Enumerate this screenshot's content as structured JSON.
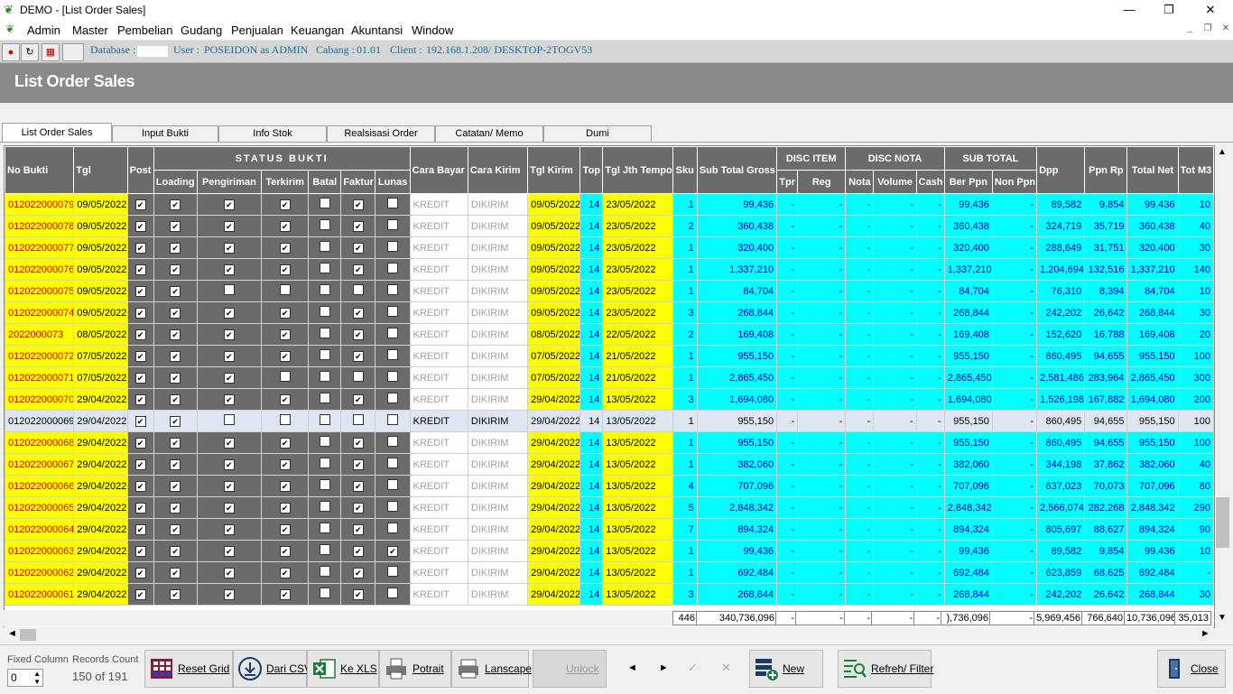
{
  "window": {
    "title": "DEMO - [List Order Sales]",
    "minimize": "—",
    "restore": "❐",
    "close": "✕"
  },
  "menu": [
    "Admin",
    "Master",
    "Pembelian",
    "Gudang",
    "Penjualan",
    "Keuangan",
    "Akuntansi",
    "Window"
  ],
  "infobar": {
    "database_label": "Database :",
    "user_label": "User :",
    "user_value": "POSEIDON as ADMIN",
    "cabang_label": "Cabang :",
    "cabang_value": "01.01",
    "client_label": "Client :",
    "client_value": "192.168.1.208/ DESKTOP-2TOGV53"
  },
  "page_title": "List Order Sales",
  "tabs": [
    "List Order Sales",
    "Input Bukti",
    "Info Stok",
    "Realsisasi Order",
    "Catatan/ Memo",
    "Dumi"
  ],
  "headers": {
    "no_bukti": "No Bukti",
    "tgl": "Tgl",
    "post": "Post",
    "status_bukti": "STATUS BUKTI",
    "loading": "Loading",
    "pengiriman": "Pengiriman",
    "terkirim": "Terkirim",
    "batal": "Batal",
    "faktur": "Faktur",
    "lunas": "Lunas",
    "cara_bayar": "Cara Bayar",
    "cara_kirim": "Cara Kirim",
    "tgl_kirim": "Tgl Kirim",
    "top": "Top",
    "tgl_jth_tempo": "Tgl Jth Tempo",
    "sku": "Sku",
    "sub_total_gross": "Sub Total Gross",
    "disc_item": "DISC ITEM",
    "tpr": "Tpr",
    "reg": "Reg",
    "disc_nota": "DISC NOTA",
    "nota": "Nota",
    "volume": "Volume",
    "cash": "Cash",
    "sub_total": "SUB TOTAL",
    "ber_ppn": "Ber Ppn",
    "non_ppn": "Non Ppn",
    "dpp": "Dpp",
    "ppn_rp": "Ppn Rp",
    "total_net": "Total Net",
    "tot_m3": "Tot M3"
  },
  "rows": [
    {
      "no": "012022000079",
      "tgl": "09/05/2022",
      "ck": [
        1,
        1,
        1,
        1,
        0,
        1,
        0
      ],
      "bayar": "KREDIT",
      "kirim": "DIKIRIM",
      "tglkirim": "09/05/2022",
      "top": "14",
      "jth": "23/05/2022",
      "sku": "1",
      "gross": "99,436",
      "tpr": "-",
      "reg": "-",
      "nota": "-",
      "vol": "-",
      "cash": "-",
      "ber": "99,436",
      "non": "-",
      "dpp": "89,582",
      "ppn": "9,854",
      "net": "99,436",
      "m3": "10"
    },
    {
      "no": "012022000078",
      "tgl": "09/05/2022",
      "ck": [
        1,
        1,
        1,
        1,
        0,
        1,
        0
      ],
      "bayar": "KREDIT",
      "kirim": "DIKIRIM",
      "tglkirim": "09/05/2022",
      "top": "14",
      "jth": "23/05/2022",
      "sku": "2",
      "gross": "360,438",
      "tpr": "-",
      "reg": "-",
      "nota": "-",
      "vol": "-",
      "cash": "-",
      "ber": "360,438",
      "non": "-",
      "dpp": "324,719",
      "ppn": "35,719",
      "net": "360,438",
      "m3": "40"
    },
    {
      "no": "012022000077",
      "tgl": "09/05/2022",
      "ck": [
        1,
        1,
        1,
        1,
        0,
        1,
        0
      ],
      "bayar": "KREDIT",
      "kirim": "DIKIRIM",
      "tglkirim": "09/05/2022",
      "top": "14",
      "jth": "23/05/2022",
      "sku": "1",
      "gross": "320,400",
      "tpr": "-",
      "reg": "-",
      "nota": "-",
      "vol": "-",
      "cash": "-",
      "ber": "320,400",
      "non": "-",
      "dpp": "288,649",
      "ppn": "31,751",
      "net": "320,400",
      "m3": "30"
    },
    {
      "no": "012022000076",
      "tgl": "09/05/2022",
      "ck": [
        1,
        1,
        1,
        1,
        0,
        1,
        0
      ],
      "bayar": "KREDIT",
      "kirim": "DIKIRIM",
      "tglkirim": "09/05/2022",
      "top": "14",
      "jth": "23/05/2022",
      "sku": "1",
      "gross": "1,337,210",
      "tpr": "-",
      "reg": "-",
      "nota": "-",
      "vol": "-",
      "cash": "-",
      "ber": "1,337,210",
      "non": "-",
      "dpp": "1,204,694",
      "ppn": "132,516",
      "net": "1,337,210",
      "m3": "140"
    },
    {
      "no": "012022000075",
      "tgl": "09/05/2022",
      "ck": [
        1,
        1,
        0,
        0,
        0,
        0,
        0
      ],
      "bayar": "KREDIT",
      "kirim": "DIKIRIM",
      "tglkirim": "09/05/2022",
      "top": "14",
      "jth": "23/05/2022",
      "sku": "1",
      "gross": "84,704",
      "tpr": "-",
      "reg": "-",
      "nota": "-",
      "vol": "-",
      "cash": "-",
      "ber": "84,704",
      "non": "-",
      "dpp": "76,310",
      "ppn": "8,394",
      "net": "84,704",
      "m3": "10"
    },
    {
      "no": "012022000074",
      "tgl": "09/05/2022",
      "ck": [
        1,
        1,
        1,
        1,
        0,
        1,
        0
      ],
      "bayar": "KREDIT",
      "kirim": "DIKIRIM",
      "tglkirim": "09/05/2022",
      "top": "14",
      "jth": "23/05/2022",
      "sku": "3",
      "gross": "268,844",
      "tpr": "-",
      "reg": "-",
      "nota": "-",
      "vol": "-",
      "cash": "-",
      "ber": "268,844",
      "non": "-",
      "dpp": "242,202",
      "ppn": "26,642",
      "net": "268,844",
      "m3": "30"
    },
    {
      "no": "2022000073",
      "tgl": "08/05/2022",
      "ck": [
        1,
        1,
        1,
        1,
        0,
        1,
        0
      ],
      "bayar": "KREDIT",
      "kirim": "DIKIRIM",
      "tglkirim": "08/05/2022",
      "top": "14",
      "jth": "22/05/2022",
      "sku": "2",
      "gross": "169,408",
      "tpr": "-",
      "reg": "-",
      "nota": "-",
      "vol": "-",
      "cash": "-",
      "ber": "169,408",
      "non": "-",
      "dpp": "152,620",
      "ppn": "16,788",
      "net": "169,408",
      "m3": "20"
    },
    {
      "no": "012022000072",
      "tgl": "07/05/2022",
      "ck": [
        1,
        1,
        1,
        1,
        0,
        1,
        0
      ],
      "bayar": "KREDIT",
      "kirim": "DIKIRIM",
      "tglkirim": "07/05/2022",
      "top": "14",
      "jth": "21/05/2022",
      "sku": "1",
      "gross": "955,150",
      "tpr": "-",
      "reg": "-",
      "nota": "-",
      "vol": "-",
      "cash": "-",
      "ber": "955,150",
      "non": "-",
      "dpp": "860,495",
      "ppn": "94,655",
      "net": "955,150",
      "m3": "100"
    },
    {
      "no": "012022000071",
      "tgl": "07/05/2022",
      "ck": [
        1,
        1,
        1,
        0,
        0,
        0,
        0
      ],
      "bayar": "KREDIT",
      "kirim": "DIKIRIM",
      "tglkirim": "07/05/2022",
      "top": "14",
      "jth": "21/05/2022",
      "sku": "1",
      "gross": "2,865,450",
      "tpr": "-",
      "reg": "-",
      "nota": "-",
      "vol": "-",
      "cash": "-",
      "ber": "2,865,450",
      "non": "-",
      "dpp": "2,581,486",
      "ppn": "283,964",
      "net": "2,865,450",
      "m3": "300"
    },
    {
      "no": "012022000070",
      "tgl": "29/04/2022",
      "ck": [
        1,
        1,
        1,
        1,
        0,
        1,
        0
      ],
      "bayar": "KREDIT",
      "kirim": "DIKIRIM",
      "tglkirim": "29/04/2022",
      "top": "14",
      "jth": "13/05/2022",
      "sku": "3",
      "gross": "1,694,080",
      "tpr": "-",
      "reg": "-",
      "nota": "-",
      "vol": "-",
      "cash": "-",
      "ber": "1,694,080",
      "non": "-",
      "dpp": "1,526,198",
      "ppn": "167,882",
      "net": "1,694,080",
      "m3": "200"
    },
    {
      "no": "012022000069",
      "tgl": "29/04/2022",
      "ck": [
        1,
        1,
        0,
        0,
        0,
        0,
        0
      ],
      "bayar": "KREDIT",
      "kirim": "DIKIRIM",
      "tglkirim": "29/04/2022",
      "top": "14",
      "jth": "13/05/2022",
      "sku": "1",
      "gross": "955,150",
      "tpr": "-",
      "reg": "-",
      "nota": "-",
      "vol": "-",
      "cash": "-",
      "ber": "955,150",
      "non": "-",
      "dpp": "860,495",
      "ppn": "94,655",
      "net": "955,150",
      "m3": "100",
      "selected": true
    },
    {
      "no": "012022000068",
      "tgl": "29/04/2022",
      "ck": [
        1,
        1,
        1,
        1,
        0,
        1,
        0
      ],
      "bayar": "KREDIT",
      "kirim": "DIKIRIM",
      "tglkirim": "29/04/2022",
      "top": "14",
      "jth": "13/05/2022",
      "sku": "1",
      "gross": "955,150",
      "tpr": "-",
      "reg": "-",
      "nota": "-",
      "vol": "-",
      "cash": "-",
      "ber": "955,150",
      "non": "-",
      "dpp": "860,495",
      "ppn": "94,655",
      "net": "955,150",
      "m3": "100"
    },
    {
      "no": "012022000067",
      "tgl": "29/04/2022",
      "ck": [
        1,
        1,
        1,
        1,
        0,
        1,
        0
      ],
      "bayar": "KREDIT",
      "kirim": "DIKIRIM",
      "tglkirim": "29/04/2022",
      "top": "14",
      "jth": "13/05/2022",
      "sku": "1",
      "gross": "382,060",
      "tpr": "-",
      "reg": "-",
      "nota": "-",
      "vol": "-",
      "cash": "-",
      "ber": "382,060",
      "non": "-",
      "dpp": "344,198",
      "ppn": "37,862",
      "net": "382,060",
      "m3": "40"
    },
    {
      "no": "012022000066",
      "tgl": "29/04/2022",
      "ck": [
        1,
        1,
        1,
        1,
        0,
        1,
        0
      ],
      "bayar": "KREDIT",
      "kirim": "DIKIRIM",
      "tglkirim": "29/04/2022",
      "top": "14",
      "jth": "13/05/2022",
      "sku": "4",
      "gross": "707,096",
      "tpr": "-",
      "reg": "-",
      "nota": "-",
      "vol": "-",
      "cash": "-",
      "ber": "707,096",
      "non": "-",
      "dpp": "637,023",
      "ppn": "70,073",
      "net": "707,096",
      "m3": "80"
    },
    {
      "no": "012022000065",
      "tgl": "29/04/2022",
      "ck": [
        1,
        1,
        1,
        1,
        0,
        1,
        0
      ],
      "bayar": "KREDIT",
      "kirim": "DIKIRIM",
      "tglkirim": "29/04/2022",
      "top": "14",
      "jth": "13/05/2022",
      "sku": "5",
      "gross": "2,848,342",
      "tpr": "-",
      "reg": "-",
      "nota": "-",
      "vol": "-",
      "cash": "-",
      "ber": "2,848,342",
      "non": "-",
      "dpp": "2,566,074",
      "ppn": "282,268",
      "net": "2,848,342",
      "m3": "290"
    },
    {
      "no": "012022000064",
      "tgl": "29/04/2022",
      "ck": [
        1,
        1,
        1,
        1,
        0,
        1,
        0
      ],
      "bayar": "KREDIT",
      "kirim": "DIKIRIM",
      "tglkirim": "29/04/2022",
      "top": "14",
      "jth": "13/05/2022",
      "sku": "7",
      "gross": "894,324",
      "tpr": "-",
      "reg": "-",
      "nota": "-",
      "vol": "-",
      "cash": "-",
      "ber": "894,324",
      "non": "-",
      "dpp": "805,697",
      "ppn": "88,627",
      "net": "894,324",
      "m3": "90"
    },
    {
      "no": "012022000063",
      "tgl": "29/04/2022",
      "ck": [
        1,
        1,
        1,
        1,
        0,
        1,
        1
      ],
      "bayar": "KREDIT",
      "kirim": "DIKIRIM",
      "tglkirim": "29/04/2022",
      "top": "14",
      "jth": "13/05/2022",
      "sku": "1",
      "gross": "99,436",
      "tpr": "-",
      "reg": "-",
      "nota": "-",
      "vol": "-",
      "cash": "-",
      "ber": "99,436",
      "non": "-",
      "dpp": "89,582",
      "ppn": "9,854",
      "net": "99,436",
      "m3": "10"
    },
    {
      "no": "012022000062",
      "tgl": "29/04/2022",
      "ck": [
        1,
        1,
        1,
        1,
        0,
        1,
        0
      ],
      "bayar": "KREDIT",
      "kirim": "DIKIRIM",
      "tglkirim": "29/04/2022",
      "top": "14",
      "jth": "13/05/2022",
      "sku": "1",
      "gross": "692,484",
      "tpr": "-",
      "reg": "-",
      "nota": "-",
      "vol": "-",
      "cash": "-",
      "ber": "692,484",
      "non": "-",
      "dpp": "623,859",
      "ppn": "68,625",
      "net": "692,484",
      "m3": "-"
    },
    {
      "no": "012022000061",
      "tgl": "29/04/2022",
      "ck": [
        1,
        1,
        1,
        1,
        0,
        1,
        0
      ],
      "bayar": "KREDIT",
      "kirim": "DIKIRIM",
      "tglkirim": "29/04/2022",
      "top": "14",
      "jth": "13/05/2022",
      "sku": "3",
      "gross": "268,844",
      "tpr": "-",
      "reg": "-",
      "nota": "-",
      "vol": "-",
      "cash": "-",
      "ber": "268,844",
      "non": "-",
      "dpp": "242,202",
      "ppn": "26,642",
      "net": "268,844",
      "m3": "30"
    }
  ],
  "totals": {
    "sku": "446",
    "gross": "340,736,096",
    "tpr": "-",
    "reg": "-",
    "nota": "-",
    "vol": "-",
    "cash": "-",
    "ber": "),736,096",
    "non": "-",
    "dpp": "5,969,456",
    "ppn": "766,640",
    "net": "10,736,096",
    "m3": "35,013"
  },
  "footer": {
    "fixed_column_label": "Fixed Column",
    "fixed_column_value": "0",
    "records_label": "Records Count",
    "records_value": "150 of 191",
    "reset_grid": "Reset Grid",
    "dari_csv": "Dari CSV",
    "ke_xls": "Ke XLS",
    "potrait": "Potrait",
    "lanscape": "Lanscape",
    "unlock": "Unlock",
    "prev": "◄",
    "next": "►",
    "check": "✓",
    "cross": "✕",
    "new": "New",
    "refresh": "Refreh/ Filter",
    "close": "Close"
  },
  "colors": {
    "header_bg": "#6b6b6b",
    "yellow": "#ffff00",
    "cyan": "#00ffff",
    "red_text": "#e00000",
    "blue_text": "#0000c0",
    "selected": "#dde6f2"
  }
}
